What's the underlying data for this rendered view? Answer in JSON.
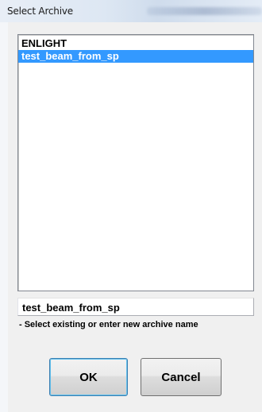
{
  "window": {
    "title": "Select Archive"
  },
  "archive_list": {
    "items": [
      {
        "label": "ENLIGHT",
        "selected": false
      },
      {
        "label": "test_beam_from_sp",
        "selected": true
      }
    ]
  },
  "name_input": {
    "value": "test_beam_from_sp"
  },
  "hint": {
    "text": "- Select existing or enter new archive name"
  },
  "buttons": {
    "ok_label": "OK",
    "cancel_label": "Cancel"
  },
  "colors": {
    "selection": "#3399ff",
    "selection_text": "#ffffff",
    "default_button_border": "#3c7fb1"
  }
}
